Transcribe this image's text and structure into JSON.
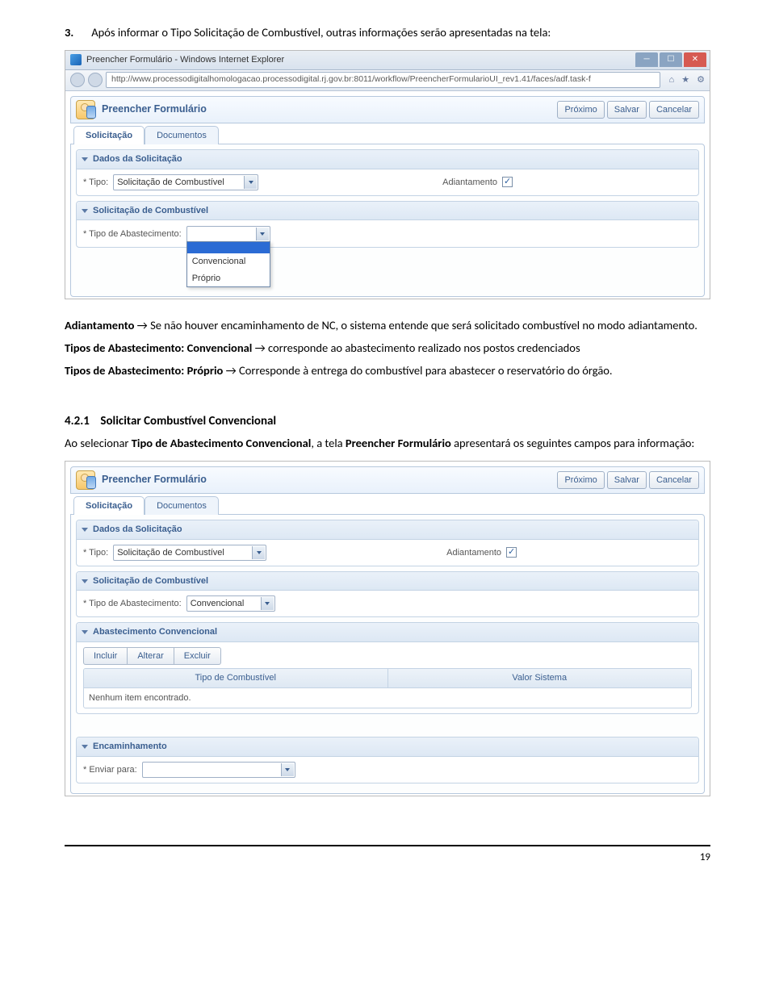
{
  "doc": {
    "step_num": "3.",
    "step_text": "Após informar o Tipo Solicitação de Combustível, outras informações serão apresentadas na tela:",
    "p1a": "Adiantamento",
    "p1b": " → Se não houver encaminhamento de NC, o sistema entende que será solicitado combustível no modo adiantamento.",
    "p2a": "Tipos de Abastecimento: Convencional",
    "p2b": " → corresponde ao abastecimento realizado nos postos credenciados",
    "p3a": "Tipos de Abastecimento: Próprio",
    "p3b": " → Corresponde à entrega do combustível para abastecer o reservatório do órgão.",
    "sec_num": "4.2.1",
    "sec_title": "Solicitar Combustível Convencional",
    "p4a": "Ao selecionar ",
    "p4b": "Tipo de Abastecimento Convencional",
    "p4c": ", a tela ",
    "p4d": "Preencher Formulário",
    "p4e": " apresentará os seguintes campos para informação:",
    "page_num": "19"
  },
  "ie": {
    "title": "Preencher Formulário - Windows Internet Explorer",
    "url": "http://www.processodigitalhomologacao.processodigital.rj.gov.br:8011/workflow/PreencherFormularioUI_rev1.41/faces/adf.task-f"
  },
  "form": {
    "title": "Preencher Formulário",
    "btn_next": "Próximo",
    "btn_save": "Salvar",
    "btn_cancel": "Cancelar",
    "tab1": "Solicitação",
    "tab2": "Documentos",
    "sec_dados": "Dados da Solicitação",
    "lbl_tipo": "Tipo:",
    "val_tipo": "Solicitação de Combustível",
    "lbl_adiant": "Adiantamento",
    "sec_comb": "Solicitação de Combustível",
    "lbl_abast": "Tipo de Abastecimento:",
    "dd_blank": "",
    "dd_opt1": "Convencional",
    "dd_opt2": "Próprio",
    "sec_abconv": "Abastecimento Convencional",
    "tb_incluir": "Incluir",
    "tb_alterar": "Alterar",
    "tb_excluir": "Excluir",
    "col1": "Tipo de Combustível",
    "col2": "Valor Sistema",
    "empty": "Nenhum item encontrado.",
    "sec_encam": "Encaminhamento",
    "lbl_enviar": "Enviar para:"
  }
}
